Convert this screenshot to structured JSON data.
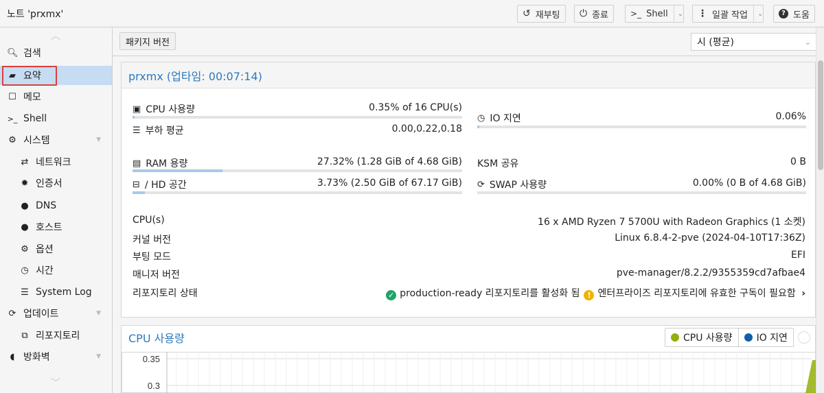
{
  "node_title": "노트 'prxmx'",
  "toolbar": {
    "reboot": "재부팅",
    "shutdown": "종료",
    "shell": "Shell",
    "bulk": "일괄 작업",
    "help": "도움"
  },
  "sidebar": {
    "items": [
      {
        "label": "검색",
        "icon": "search-icon"
      },
      {
        "label": "요약",
        "icon": "book-icon"
      },
      {
        "label": "메모",
        "icon": "note-icon"
      },
      {
        "label": "Shell",
        "icon": "terminal-icon"
      },
      {
        "label": "시스템",
        "icon": "gears-icon"
      },
      {
        "label": "네트워크",
        "icon": "exchange-icon"
      },
      {
        "label": "인증서",
        "icon": "certificate-icon"
      },
      {
        "label": "DNS",
        "icon": "globe-icon"
      },
      {
        "label": "호스트",
        "icon": "globe-icon"
      },
      {
        "label": "옵션",
        "icon": "gear-icon"
      },
      {
        "label": "시간",
        "icon": "clock-icon"
      },
      {
        "label": "System Log",
        "icon": "list-icon"
      },
      {
        "label": "업데이트",
        "icon": "refresh-icon"
      },
      {
        "label": "리포지토리",
        "icon": "files-icon"
      },
      {
        "label": "방화벽",
        "icon": "shield-icon"
      }
    ]
  },
  "subbar": {
    "package_versions": "패키지 버전",
    "time_range": "시 (평균)"
  },
  "summary": {
    "title": "prxmx (업타임: 00:07:14)",
    "cpu_label": "CPU 사용량",
    "cpu_value": "0.35% of 16 CPU(s)",
    "cpu_fraction": 0.0035,
    "load_label": "부하 평균",
    "load_value": "0.00,0.22,0.18",
    "io_label": "IO 지연",
    "io_value": "0.06%",
    "io_fraction": 0.0006,
    "ram_label": "RAM 용량",
    "ram_value": "27.32% (1.28 GiB of 4.68 GiB)",
    "ram_fraction": 0.2732,
    "hd_label": "/ HD 공간",
    "hd_value": "3.73% (2.50 GiB of 67.17 GiB)",
    "hd_fraction": 0.0373,
    "ksm_label": "KSM 공유",
    "ksm_value": "0 B",
    "swap_label": "SWAP 사용량",
    "swap_value": "0.00% (0 B of 4.68 GiB)",
    "swap_fraction": 0.0,
    "info": [
      {
        "label": "CPU(s)",
        "value": "16 x AMD Ryzen 7 5700U with Radeon Graphics (1 소켓)"
      },
      {
        "label": "커널 버전",
        "value": "Linux 6.8.4-2-pve (2024-04-10T17:36Z)"
      },
      {
        "label": "부팅 모드",
        "value": "EFI"
      },
      {
        "label": "매니저 버전",
        "value": "pve-manager/8.2.2/9355359cd7afbae4"
      }
    ],
    "repo_label": "리포지토리 상태",
    "repo_ok": "production-ready 리포지토리를 활성화 됨",
    "repo_warn": "엔터프라이즈 리포지토리에 유효한 구독이 필요함"
  },
  "cpu_chart": {
    "title": "CPU 사용량",
    "legend": [
      {
        "name": "CPU 사용량",
        "color": "#94ae0a"
      },
      {
        "name": "IO 지연",
        "color": "#115fa6"
      }
    ]
  },
  "chart_data": {
    "type": "line",
    "title": "CPU 사용량",
    "series": [
      {
        "name": "CPU 사용량",
        "values": []
      },
      {
        "name": "IO 지연",
        "values": []
      }
    ],
    "yticks": [
      "0.35",
      "0.3"
    ],
    "ylim": [
      0.3,
      0.35
    ],
    "grid": true,
    "legend_position": "top-right"
  }
}
